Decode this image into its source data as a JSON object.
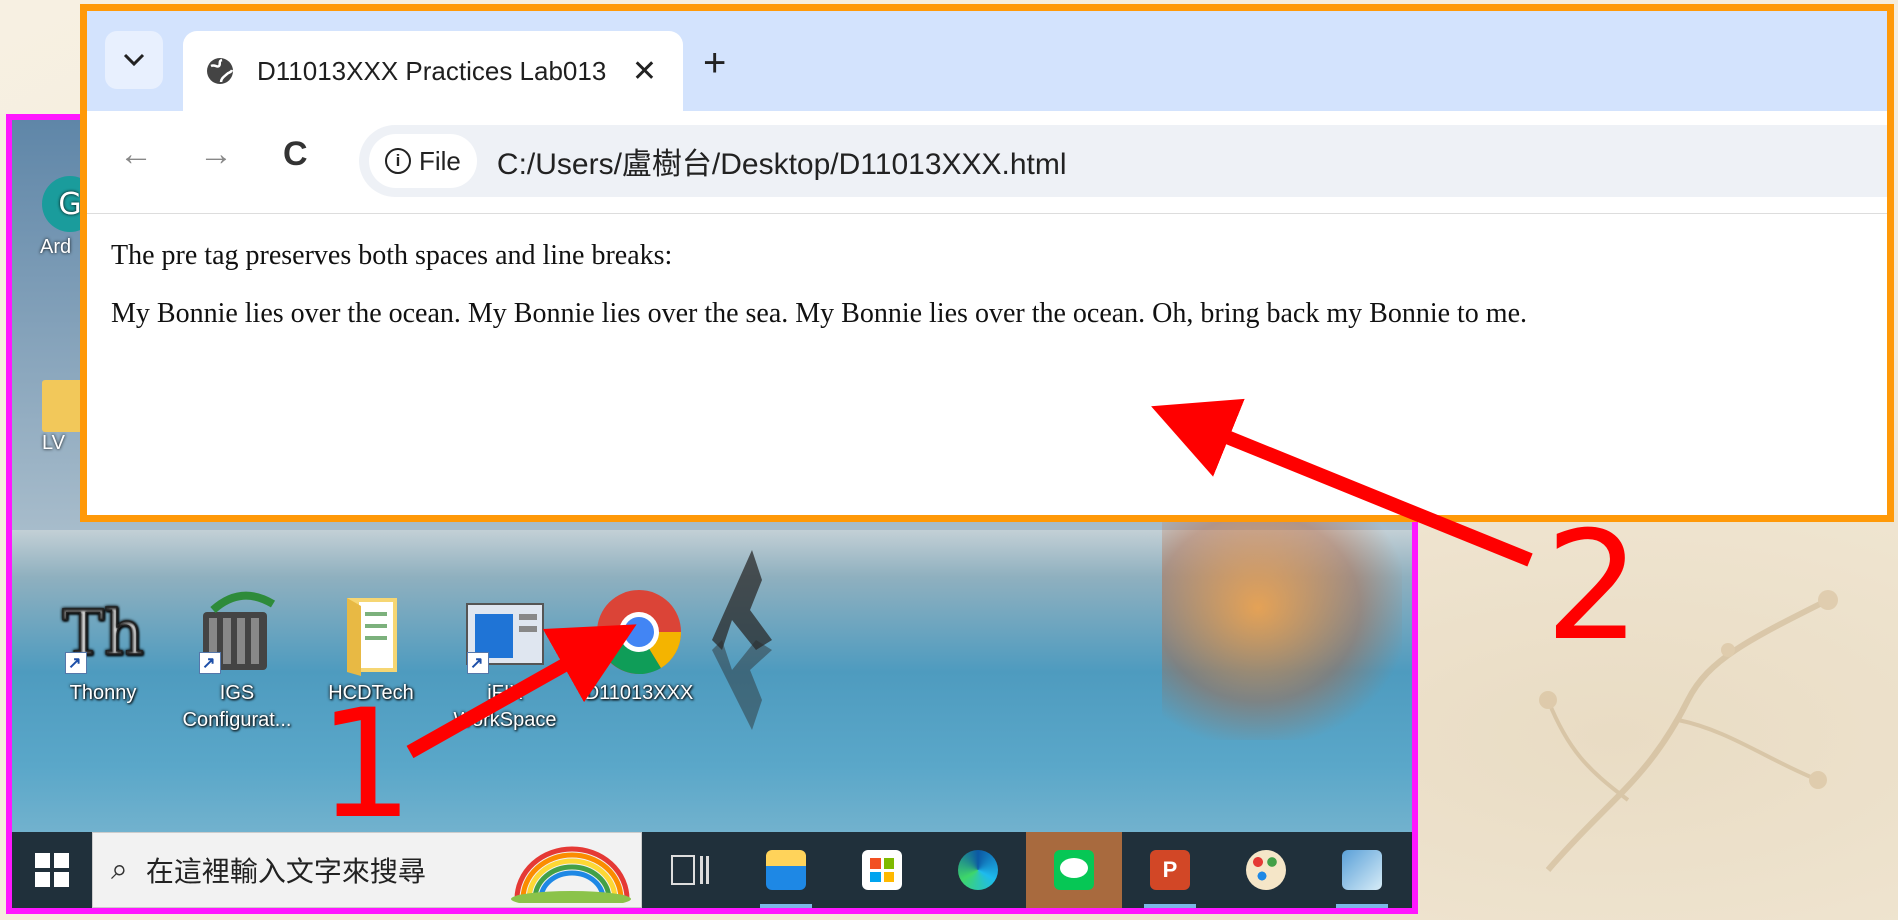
{
  "browser": {
    "tab_dropdown_icon": "chevron-down-icon",
    "tab_title": "D11013XXX Practices Lab013",
    "tab_close": "✕",
    "new_tab": "+",
    "back": "←",
    "forward": "→",
    "reload": "C",
    "site_chip": "File",
    "url": "C:/Users/盧樹台/Desktop/D11013XXX.html"
  },
  "page": {
    "line1": "The pre tag preserves both spaces and line breaks:",
    "line2": "My Bonnie lies over the ocean. My Bonnie lies over the sea. My Bonnie lies over the ocean. Oh, bring back my Bonnie to me."
  },
  "desktop": {
    "partial_labels": [
      "Ard",
      "LV"
    ],
    "icons": [
      {
        "name": "thonny",
        "label": "Thonny"
      },
      {
        "name": "igs",
        "label": "IGS Configurat..."
      },
      {
        "name": "hcdtech",
        "label": "HCDTech"
      },
      {
        "name": "ifix",
        "label": "iFIX WorkSpace"
      },
      {
        "name": "d11013xxx",
        "label": "D11013XXX"
      }
    ]
  },
  "taskbar": {
    "search_placeholder": "在這裡輸入文字來搜尋"
  },
  "annotations": {
    "label1": "1",
    "label2": "2"
  },
  "colors": {
    "annotation_red": "#ff0000",
    "browser_frame": "#ff9908",
    "desktop_frame": "#ff17ff"
  }
}
